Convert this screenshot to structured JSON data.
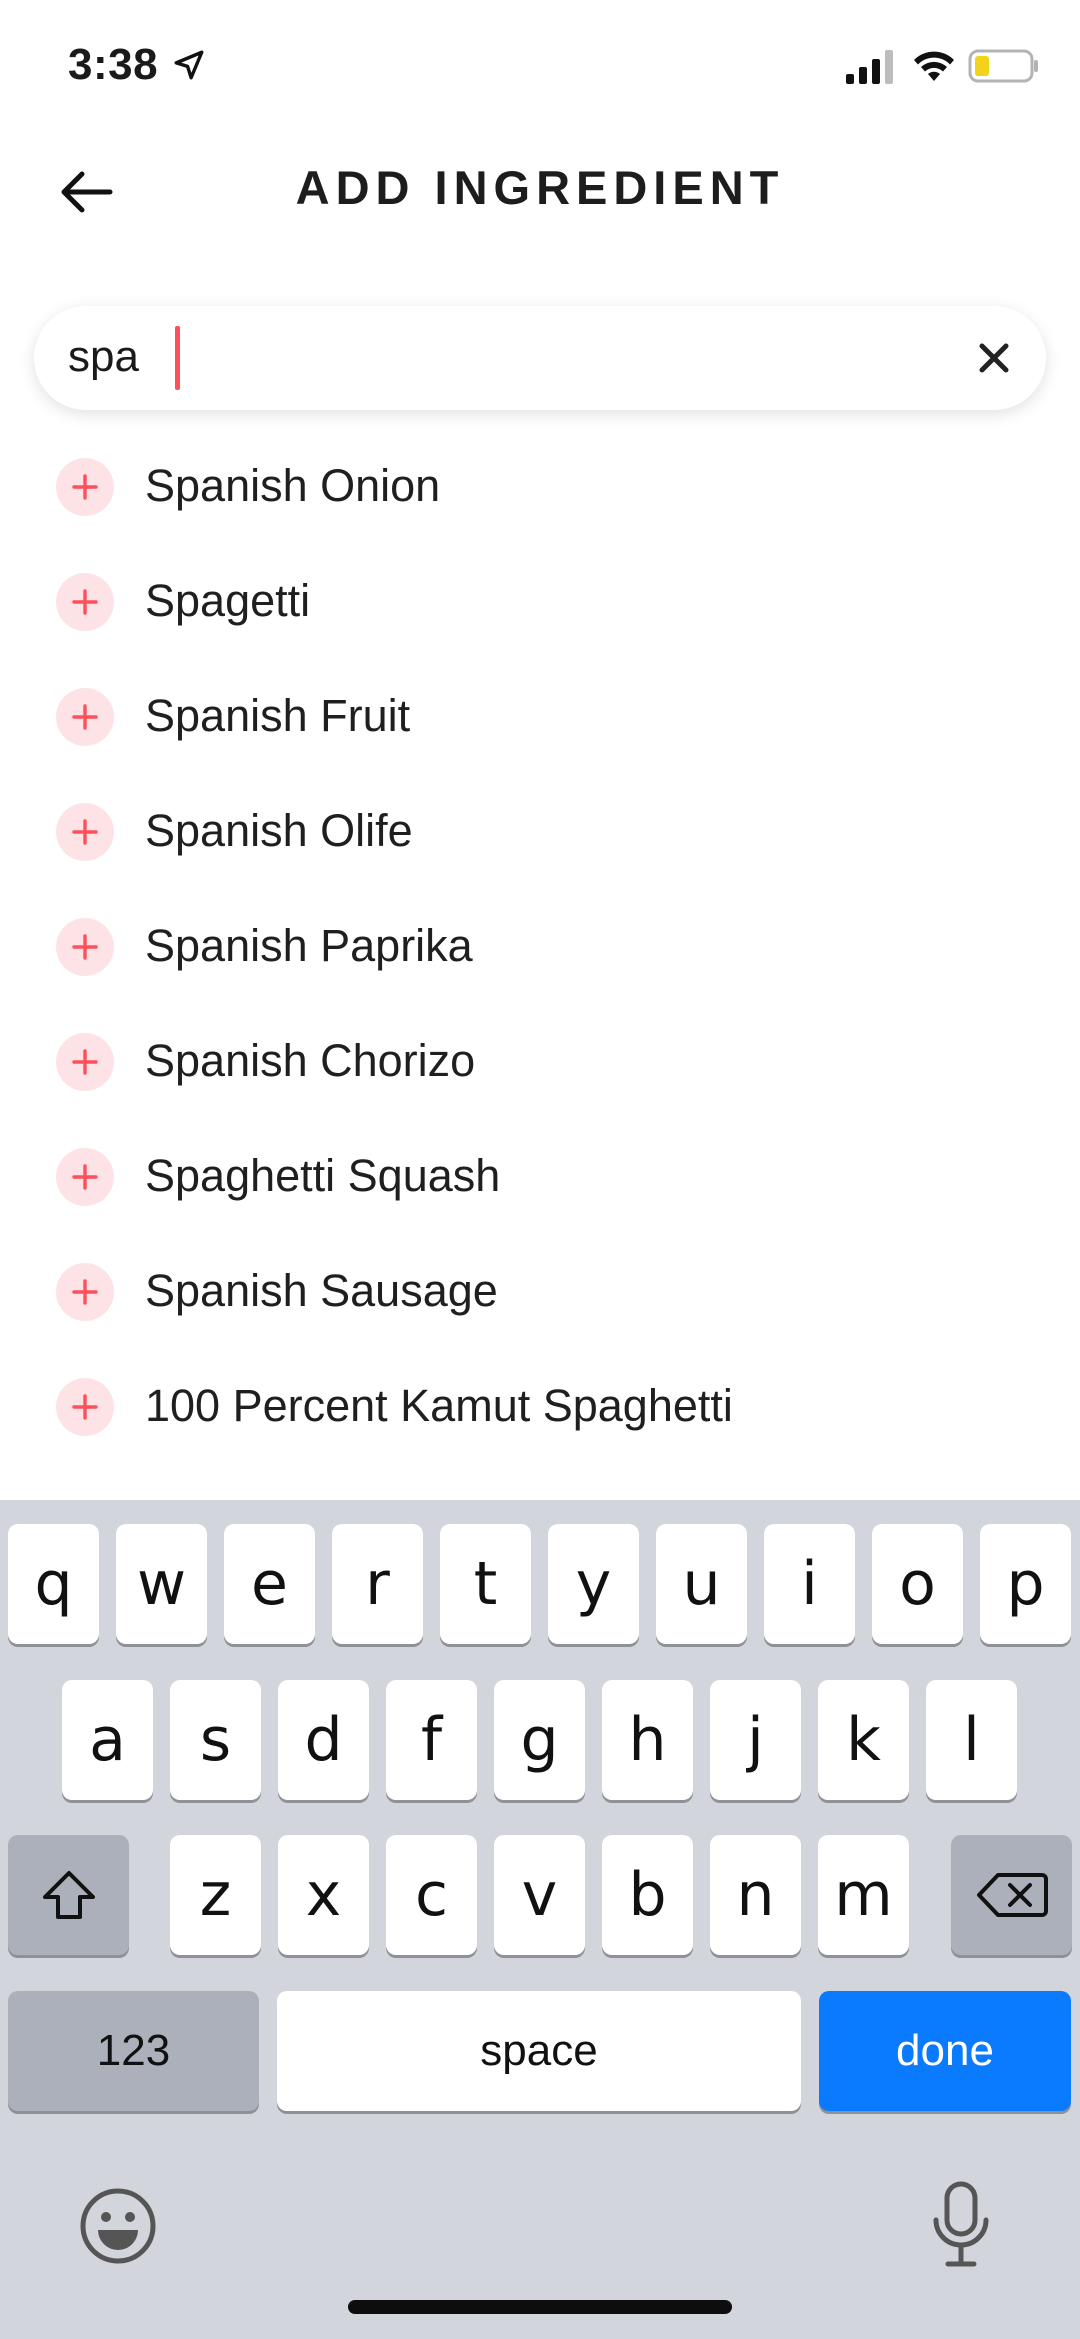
{
  "status_bar": {
    "time": "3:38",
    "icons": [
      "location-arrow-icon",
      "signal-icon",
      "wifi-icon",
      "battery-icon"
    ]
  },
  "header": {
    "title": "ADD INGREDIENT",
    "back_icon": "back-arrow-icon"
  },
  "search": {
    "value": "spa",
    "clear_icon": "close-icon"
  },
  "results": [
    {
      "label": "Spanish Onion"
    },
    {
      "label": "Spagetti"
    },
    {
      "label": "Spanish Fruit"
    },
    {
      "label": "Spanish Olife"
    },
    {
      "label": "Spanish Paprika"
    },
    {
      "label": "Spanish Chorizo"
    },
    {
      "label": "Spaghetti Squash"
    },
    {
      "label": "Spanish Sausage"
    },
    {
      "label": "100 Percent Kamut Spaghetti"
    }
  ],
  "keyboard": {
    "row1": [
      "q",
      "w",
      "e",
      "r",
      "t",
      "y",
      "u",
      "i",
      "o",
      "p"
    ],
    "row2": [
      "a",
      "s",
      "d",
      "f",
      "g",
      "h",
      "j",
      "k",
      "l"
    ],
    "row3": [
      "z",
      "x",
      "c",
      "v",
      "b",
      "n",
      "m"
    ],
    "numbers_label": "123",
    "space_label": "space",
    "done_label": "done"
  },
  "colors": {
    "accent": "#ff4f5a",
    "add_icon_bg": "#fde3e6",
    "done_key": "#0a7aff",
    "keyboard_bg": "#d2d5db"
  }
}
